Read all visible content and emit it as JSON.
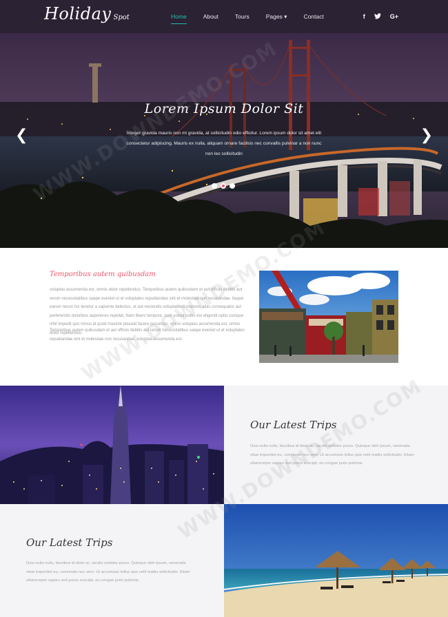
{
  "nav": {
    "brand": "Holiday",
    "brand_sub": "Spot",
    "items": [
      {
        "label": "Home",
        "active": true
      },
      {
        "label": "About",
        "active": false
      },
      {
        "label": "Tours",
        "active": false
      },
      {
        "label": "Pages ▾",
        "active": false
      },
      {
        "label": "Contact",
        "active": false
      }
    ],
    "social": [
      "f",
      "t",
      "G+"
    ]
  },
  "hero": {
    "title": "Lorem Ipsum Dolor Sit",
    "text": "Integer gravida mauris non mi gravida, at sollicitudin odio efficitur. Lorem ipsum dolor sit amet elit consectetur adipiscing. Mauris ex nulla, aliquam ornare facilisis nec convallis pulvinar a non nunc non leo sollicitudin",
    "prev": "❮",
    "next": "❯",
    "accent": "#ff4e7a"
  },
  "about": {
    "title": "Temporibus autem quibusdam",
    "p1": "voluptas assumenda est, omnis dolor repellendus. Temporibus autem quibusdam et aut officiis debitis aut rerum necessitatibus saepe eveniet ut et voluptates repudiandae sint et molestiae non recusandae. Itaque earum rerum hic tenetur a sapiente delectus, ut aut reiciendis voluptatibus maiores alias consequatur aut perferendis doloribus asperiores repellat. Nam libero tempore, cum soluta nobis est eligendi optio cumque nihil impedit quo minus id quod maxime placeat facere possimus, omnis voluptas assumenda est, omnis dolor repellendus.",
    "p2": "Temporibus autem quibusdam et aut officiis debitis aut rerum necessitatibus saepe eveniet ut et voluptates repudiandae sint et molestiae non recusandae. voluptas assumenda est.",
    "title_color": "#ef5569"
  },
  "trips": [
    {
      "title": "Our Latest Trips",
      "text": "Duis nulla nulla, faucibus id diam ac, iaculis sodales purus. Quisque nibh ipsum, venenatis vitae imperdiet eu, commodo nec sem. Ut accumsan tellus quis velit mattis sollicitudin. Etiam ullamcorper sapien sed purus suscipit, eu congue justo pulvinar."
    },
    {
      "title": "Our Latest Trips",
      "text": "Duis nulla nulla, faucibus id diam ac, iaculis sodales purus. Quisque nibh ipsum, venenatis vitae imperdiet eu, commodo nec sem. Ut accumsan tellus quis velit mattis sollicitudin. Etiam ullamcorper sapien sed purus suscipit, eu congue justo pulvinar."
    }
  ],
  "watermark": "WWW.DOWNDEMO.COM"
}
